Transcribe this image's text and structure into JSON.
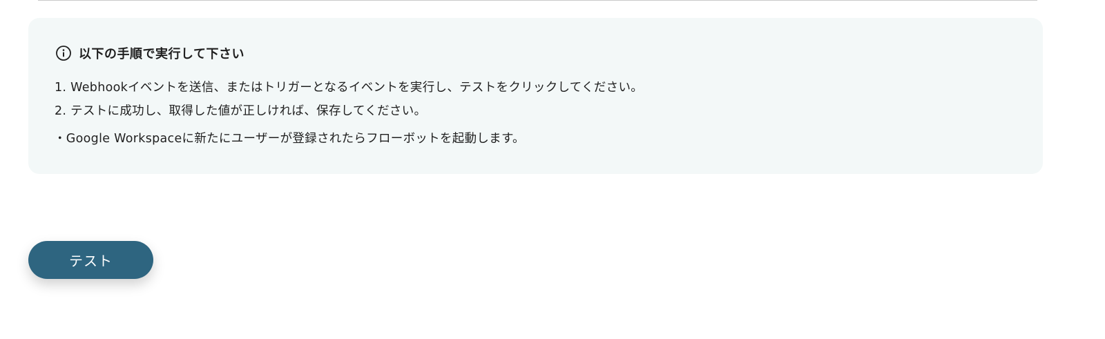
{
  "info_panel": {
    "icon": "info-circle-icon",
    "title": "以下の手順で実行して下さい",
    "steps": [
      "1. Webhookイベントを送信、またはトリガーとなるイベントを実行し、テストをクリックしてください。",
      "2. テストに成功し、取得した値が正しければ、保存してください。"
    ],
    "note": "・Google Workspaceに新たにユーザーが登録されたらフローボットを起動します。"
  },
  "test_button": {
    "label": "テスト",
    "color": "#2e6580"
  },
  "colors": {
    "panel_background": "#f3f8f8",
    "text": "#1f1f1f"
  }
}
